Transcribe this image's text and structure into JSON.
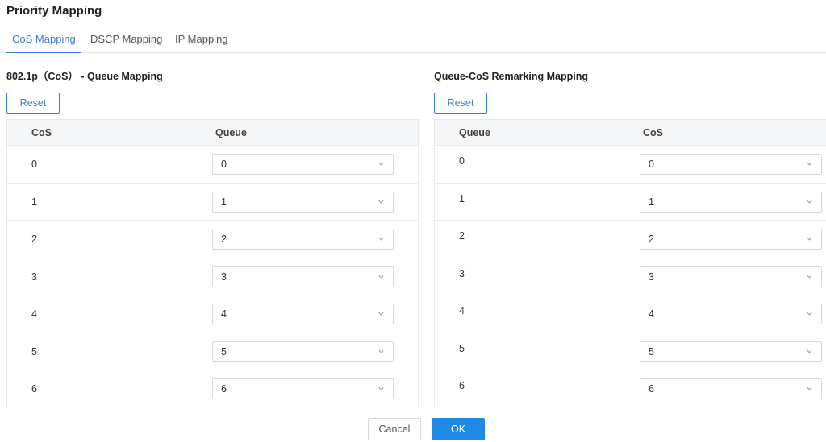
{
  "page_title": "Priority Mapping",
  "tabs": [
    {
      "label": "CoS Mapping",
      "active": true
    },
    {
      "label": "DSCP Mapping",
      "active": false
    },
    {
      "label": "IP Mapping",
      "active": false
    }
  ],
  "left_section": {
    "title": "802.1p（CoS） - Queue Mapping",
    "reset_label": "Reset",
    "columns": [
      "CoS",
      "Queue"
    ],
    "rows": [
      {
        "key": "0",
        "value": "0"
      },
      {
        "key": "1",
        "value": "1"
      },
      {
        "key": "2",
        "value": "2"
      },
      {
        "key": "3",
        "value": "3"
      },
      {
        "key": "4",
        "value": "4"
      },
      {
        "key": "5",
        "value": "5"
      },
      {
        "key": "6",
        "value": "6"
      }
    ]
  },
  "right_section": {
    "title": "Queue-CoS Remarking Mapping",
    "reset_label": "Reset",
    "columns": [
      "Queue",
      "CoS"
    ],
    "rows": [
      {
        "key": "0",
        "value": "0"
      },
      {
        "key": "1",
        "value": "1"
      },
      {
        "key": "2",
        "value": "2"
      },
      {
        "key": "3",
        "value": "3"
      },
      {
        "key": "4",
        "value": "4"
      },
      {
        "key": "5",
        "value": "5"
      },
      {
        "key": "6",
        "value": "6"
      }
    ]
  },
  "footer": {
    "cancel_label": "Cancel",
    "ok_label": "OK"
  },
  "colors": {
    "accent": "#3b7fd9",
    "primary_button": "#1f8ae6"
  },
  "icons": {
    "select_arrow": "chevron-down-icon"
  }
}
